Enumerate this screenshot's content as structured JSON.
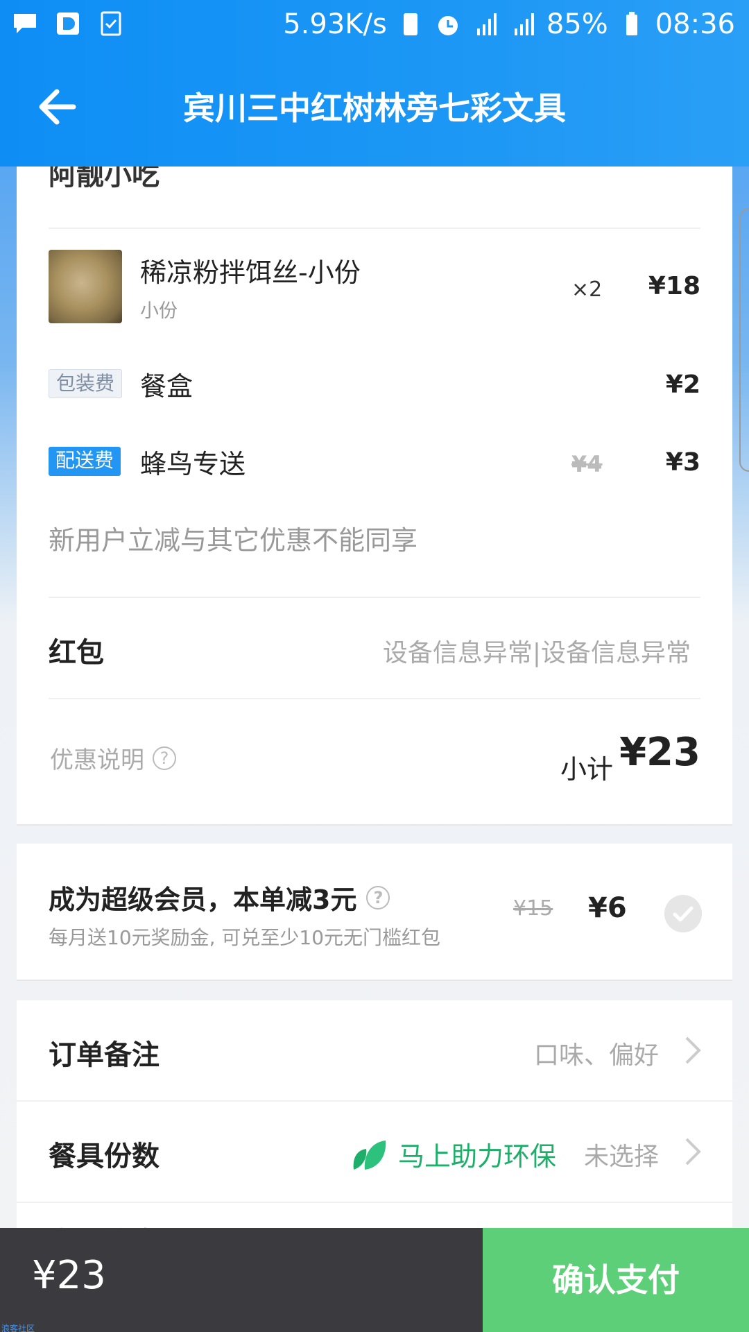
{
  "status_bar": {
    "speed": "5.93K/s",
    "network_2g": "2G",
    "network_4g": "4G",
    "battery": "85%",
    "time": "08:36"
  },
  "header": {
    "title": "宾川三中红树林旁七彩文具"
  },
  "order": {
    "shop_name": "阿靓小吃",
    "item": {
      "name": "稀凉粉拌饵丝-小份",
      "spec": "小份",
      "qty": "×2",
      "price": "¥18"
    },
    "packaging": {
      "tag": "包装费",
      "name": "餐盒",
      "price": "¥2"
    },
    "delivery": {
      "tag": "配送费",
      "name": "蜂鸟专送",
      "original_price": "¥4",
      "price": "¥3"
    },
    "notice": "新用户立减与其它优惠不能同享",
    "red_packet": {
      "label": "红包",
      "value": "设备信息异常|设备信息异常"
    },
    "promo_label": "优惠说明",
    "subtotal_label": "小计",
    "subtotal_value": "¥23"
  },
  "member": {
    "title": "成为超级会员，本单减3元",
    "subtitle": "每月送10元奖励金, 可兑至少10元无门槛红包",
    "original_price": "¥15",
    "price": "¥6"
  },
  "options": {
    "remark_label": "订单备注",
    "remark_hint": "口味、偏好",
    "tableware_label": "餐具份数",
    "eco_text": "马上助力环保",
    "tableware_hint": "未选择",
    "address_label": "发票信息"
  },
  "footer": {
    "total": "¥23",
    "pay_label": "确认支付"
  },
  "watermark": "浪客社区",
  "colors": {
    "header_blue": "#1c97f5",
    "pay_green": "#5ccf78",
    "eco_green": "#1fae6a",
    "footer_dark": "#3b3b3f"
  }
}
